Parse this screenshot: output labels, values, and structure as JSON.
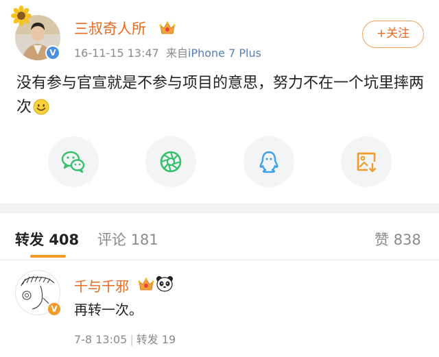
{
  "post": {
    "author": {
      "name": "三叔奇人所",
      "verified": true,
      "badge_icon": "crown-badge-icon",
      "avatar_decoration": "sunflower-icon"
    },
    "timestamp": "16-11-15 13:47",
    "source_prefix": "来自",
    "source": "iPhone 7 Plus",
    "follow_label": "+关注",
    "text": "没有参与官宣就是不参与项目的意思，努力不在一个坑里摔两次",
    "emoji": "smile-emoji-icon",
    "share_targets": [
      "wechat-icon",
      "moments-icon",
      "qq-icon",
      "save-image-icon"
    ]
  },
  "tabs": {
    "repost": {
      "label": "转发",
      "count": "408"
    },
    "comment": {
      "label": "评论",
      "count": "181"
    },
    "like": {
      "label": "赞",
      "count": "838"
    }
  },
  "reposts": [
    {
      "name": "千与千邪",
      "verified": true,
      "badge_icons": [
        "crown-badge-icon",
        "panda-icon"
      ],
      "text": "再转一次。",
      "time": "7-8 13:05",
      "repost_label": "转发",
      "repost_count": "19"
    }
  ],
  "colors": {
    "accent_orange": "#e86a1f",
    "tab_underline": "#f39a2a",
    "verify_blue": "#4a90e2",
    "verify_orange": "#f39a2a",
    "source_link": "#5b7fb0"
  }
}
